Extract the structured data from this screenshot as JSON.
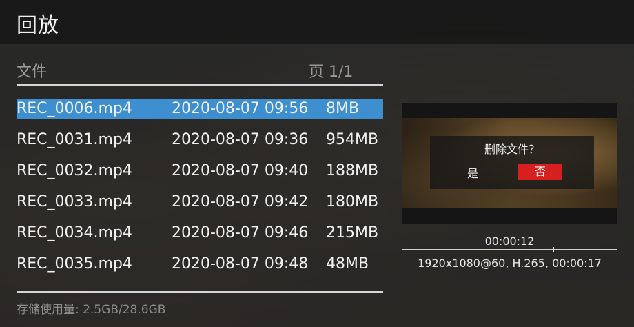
{
  "header": {
    "title": "回放"
  },
  "list": {
    "column_label": "文件",
    "page_label": "页 1/1",
    "files": [
      {
        "name": "REC_0006.mp4",
        "datetime": "2020-08-07 09:56",
        "size": "8MB",
        "selected": true
      },
      {
        "name": "REC_0031.mp4",
        "datetime": "2020-08-07 09:36",
        "size": "954MB",
        "selected": false
      },
      {
        "name": "REC_0032.mp4",
        "datetime": "2020-08-07 09:40",
        "size": "188MB",
        "selected": false
      },
      {
        "name": "REC_0033.mp4",
        "datetime": "2020-08-07 09:42",
        "size": "180MB",
        "selected": false
      },
      {
        "name": "REC_0034.mp4",
        "datetime": "2020-08-07 09:46",
        "size": "215MB",
        "selected": false
      },
      {
        "name": "REC_0035.mp4",
        "datetime": "2020-08-07 09:48",
        "size": "48MB",
        "selected": false
      }
    ],
    "storage": "存储使用量: 2.5GB/28.6GB"
  },
  "dialog": {
    "title": "删除文件？",
    "yes_label": "是",
    "no_label": "否"
  },
  "preview": {
    "timecode": "00:00:12",
    "progress_fraction": 0.7,
    "meta": "1920x1080@60, H.265, 00:00:17"
  },
  "colors": {
    "selection": "#3d8fd0",
    "no_button": "#d71f1f"
  }
}
